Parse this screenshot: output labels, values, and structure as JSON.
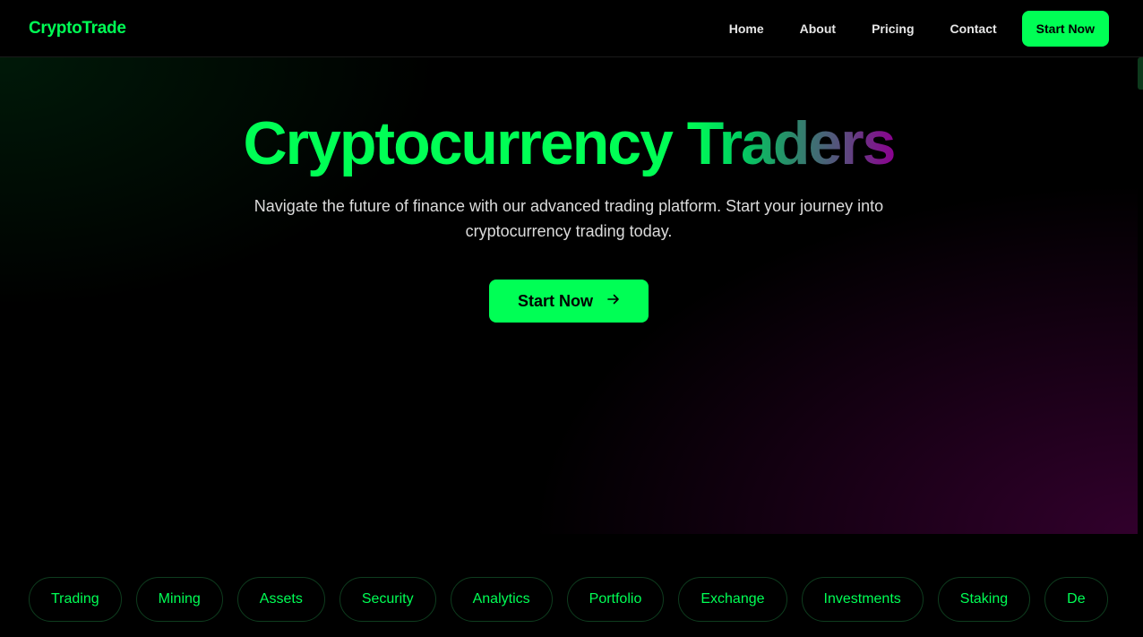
{
  "nav": {
    "brand": "CryptoTrade",
    "links": [
      "Home",
      "About",
      "Pricing",
      "Contact"
    ],
    "cta_label": "Start Now"
  },
  "hero": {
    "title_main": "Cryptocurrency",
    "title_accent": "Traders",
    "subtitle": "Navigate the future of finance with our advanced trading platform. Start your journey into cryptocurrency trading today.",
    "cta_label": "Start Now",
    "cta_icon": "arrow-right-icon"
  },
  "tags": [
    "Trading",
    "Mining",
    "Assets",
    "Security",
    "Analytics",
    "Portfolio",
    "Exchange",
    "Investments",
    "Staking",
    "De"
  ],
  "colors": {
    "accent": "#00ff55",
    "background": "#000000",
    "gradient_end": "#8c0090"
  }
}
